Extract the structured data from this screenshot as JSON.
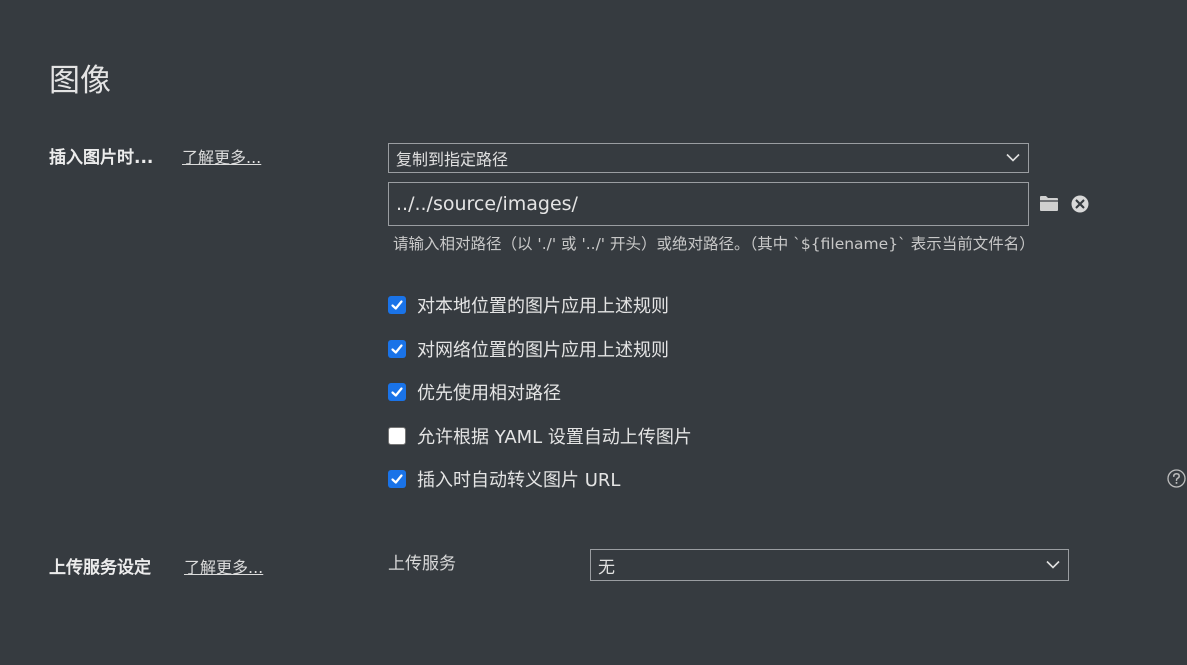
{
  "section": {
    "title": "图像"
  },
  "insert_image": {
    "label": "插入图片时...",
    "learn_more": "了解更多...",
    "action_select": "复制到指定路径",
    "path_value": "../../source/images/",
    "hint": "请输入相对路径（以 './' 或 '../' 开头）或绝对路径。（其中 `${filename}` 表示当前文件名）",
    "options": [
      {
        "label": "对本地位置的图片应用上述规则",
        "checked": true
      },
      {
        "label": "对网络位置的图片应用上述规则",
        "checked": true
      },
      {
        "label": "优先使用相对路径",
        "checked": true
      },
      {
        "label": "允许根据 YAML 设置自动上传图片",
        "checked": false
      },
      {
        "label": "插入时自动转义图片 URL",
        "checked": true
      }
    ]
  },
  "upload": {
    "label": "上传服务设定",
    "learn_more": "了解更多...",
    "service_label": "上传服务",
    "service_select": "无"
  },
  "icons": {
    "folder": "folder-icon",
    "clear": "clear-icon",
    "help": "help-icon",
    "chevron": "chevron-down-icon"
  },
  "colors": {
    "background": "#363b40",
    "checkbox_checked": "#1a73e8"
  }
}
